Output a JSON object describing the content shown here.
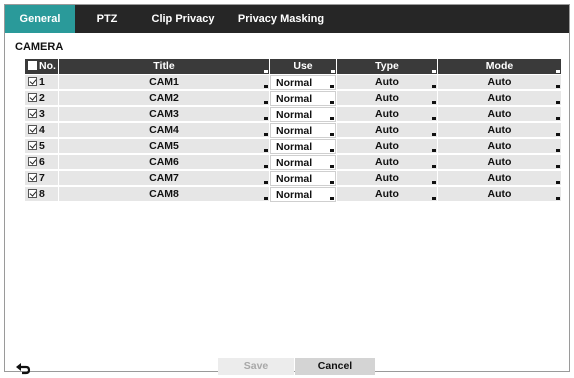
{
  "tabs": [
    {
      "label": "General",
      "active": true
    },
    {
      "label": "PTZ",
      "active": false
    },
    {
      "label": "Clip Privacy",
      "active": false
    },
    {
      "label": "Privacy Masking",
      "active": false
    }
  ],
  "section_title": "CAMERA",
  "table": {
    "headers": {
      "no": "No.",
      "title": "Title",
      "use": "Use",
      "type": "Type",
      "mode": "Mode"
    },
    "rows": [
      {
        "no": "1",
        "title": "CAM1",
        "use": "Normal",
        "type": "Auto",
        "mode": "Auto",
        "checked": true
      },
      {
        "no": "2",
        "title": "CAM2",
        "use": "Normal",
        "type": "Auto",
        "mode": "Auto",
        "checked": true
      },
      {
        "no": "3",
        "title": "CAM3",
        "use": "Normal",
        "type": "Auto",
        "mode": "Auto",
        "checked": true
      },
      {
        "no": "4",
        "title": "CAM4",
        "use": "Normal",
        "type": "Auto",
        "mode": "Auto",
        "checked": true
      },
      {
        "no": "5",
        "title": "CAM5",
        "use": "Normal",
        "type": "Auto",
        "mode": "Auto",
        "checked": true
      },
      {
        "no": "6",
        "title": "CAM6",
        "use": "Normal",
        "type": "Auto",
        "mode": "Auto",
        "checked": true
      },
      {
        "no": "7",
        "title": "CAM7",
        "use": "Normal",
        "type": "Auto",
        "mode": "Auto",
        "checked": true
      },
      {
        "no": "8",
        "title": "CAM8",
        "use": "Normal",
        "type": "Auto",
        "mode": "Auto",
        "checked": true
      }
    ]
  },
  "buttons": {
    "save": "Save",
    "cancel": "Cancel",
    "save_enabled": false
  },
  "icons": {
    "back": "back-arrow-icon"
  },
  "colors": {
    "tab_active": "#2a9a9a",
    "tabbar": "#262626",
    "header": "#3a3a3a"
  }
}
